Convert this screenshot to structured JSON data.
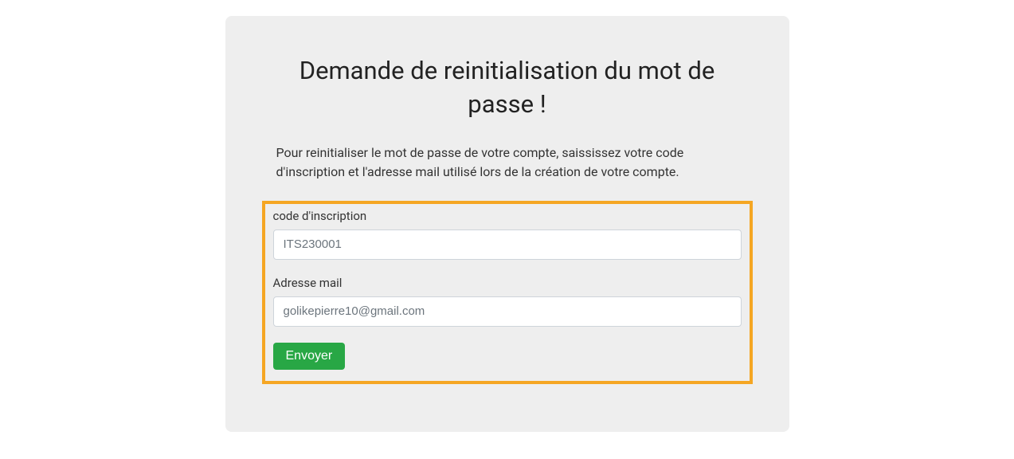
{
  "card": {
    "title": "Demande de reinitialisation du mot de passe !",
    "description": "Pour reinitialiser le mot de passe de votre compte, saississez votre code d'inscription et l'adresse mail utilisé lors de la création de votre compte."
  },
  "form": {
    "code_label": "code d'inscription",
    "code_placeholder": "ITS230001",
    "email_label": "Adresse mail",
    "email_placeholder": "golikepierre10@gmail.com",
    "submit_label": "Envoyer"
  },
  "colors": {
    "highlight_border": "#f5a623",
    "button_bg": "#28a745",
    "card_bg": "#eeeeee"
  }
}
